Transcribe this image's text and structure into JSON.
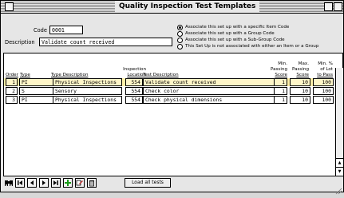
{
  "window": {
    "title": "Quality Inspection Test Templates"
  },
  "form": {
    "code_label": "Code",
    "code_value": "0001",
    "description_label": "Description",
    "description_value": "Validate count received"
  },
  "association": {
    "options": [
      {
        "label": "Associate this set up with a specific Item Code",
        "selected": true
      },
      {
        "label": "Associate this set up with a Group Code",
        "selected": false
      },
      {
        "label": "Associate this set up with a Sub-Group Code",
        "selected": false
      },
      {
        "label": "This Set Up is not associated with either an Item or a Group",
        "selected": false
      }
    ]
  },
  "table": {
    "headers": {
      "order": "Order",
      "type": "Type",
      "type_description": "Type Description",
      "inspection_location_1": "Inspection",
      "inspection_location_2": "Location",
      "test_description": "Test Description",
      "min_passing_1": "Min.",
      "min_passing_2": "Passing",
      "min_passing_3": "Score",
      "max_passing_1": "Max.",
      "max_passing_2": "Passing",
      "max_passing_3": "Score",
      "min_lot_1": "Min. %",
      "min_lot_2": "of Lot",
      "min_lot_3": "to Pass"
    },
    "rows": [
      {
        "order": "1",
        "type": "PI",
        "type_description": "Physical Inspections",
        "location": "554",
        "test_description": "Validate count received",
        "min_score": "1",
        "max_score": "10",
        "min_lot": "100",
        "selected": true
      },
      {
        "order": "2",
        "type": "S",
        "type_description": "Sensory",
        "location": "554",
        "test_description": "Check color",
        "min_score": "1",
        "max_score": "10",
        "min_lot": "100",
        "selected": false
      },
      {
        "order": "3",
        "type": "PI",
        "type_description": "Physical Inspections",
        "location": "554",
        "test_description": "Check physical dimensions",
        "min_score": "1",
        "max_score": "10",
        "min_lot": "100",
        "selected": false
      }
    ]
  },
  "toolbar": {
    "icons": [
      "binoculars-icon",
      "first-record-icon",
      "previous-record-icon",
      "next-record-icon",
      "last-record-icon",
      "add-record-icon",
      "edit-record-icon",
      "delete-record-icon"
    ],
    "load_all_label": "Load all tests"
  },
  "colors": {
    "selected_row": "#fff0a8",
    "window_bg": "#e6e6e6"
  }
}
